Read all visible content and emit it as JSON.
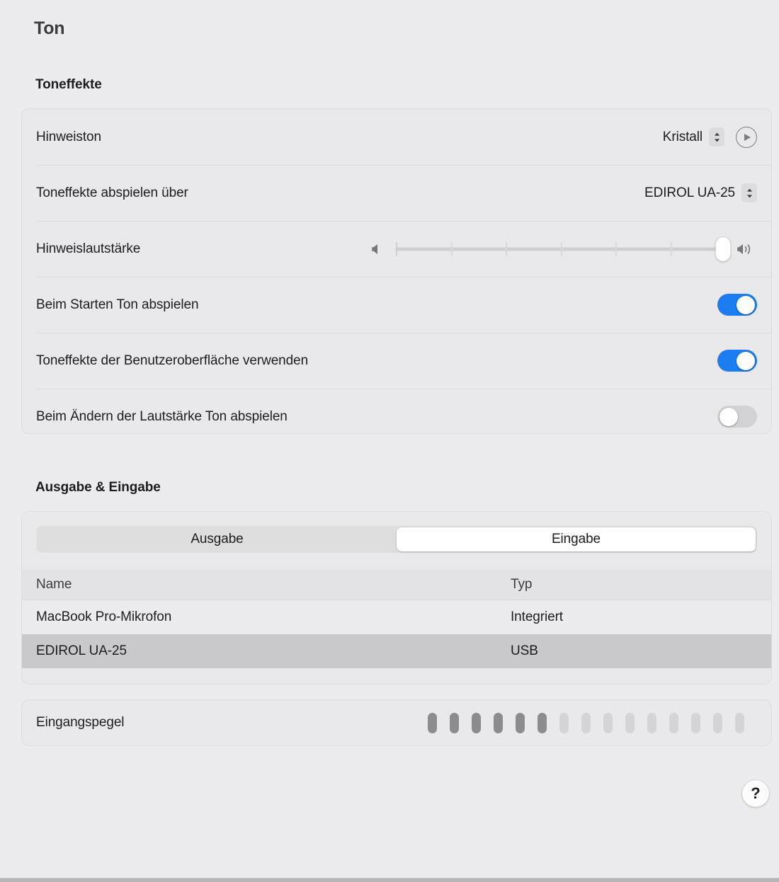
{
  "page": {
    "title": "Ton"
  },
  "sound_effects": {
    "header": "Toneffekte",
    "alert_sound": {
      "label": "Hinweiston",
      "value": "Kristall",
      "play_icon": "play-icon",
      "stepper_icon": "chevron-up-down-icon"
    },
    "play_through": {
      "label": "Toneffekte abspielen über",
      "value": "EDIROL UA-25",
      "stepper_icon": "chevron-up-down-icon"
    },
    "alert_volume": {
      "label": "Hinweislautstärke",
      "value_percent": 100,
      "tick_count": 6,
      "min_icon": "speaker-low-icon",
      "max_icon": "speaker-high-icon"
    },
    "toggles": [
      {
        "label": "Beim Starten Ton abspielen",
        "state": "on"
      },
      {
        "label": "Toneffekte der Benutzeroberfläche verwenden",
        "state": "on"
      },
      {
        "label": "Beim Ändern der Lautstärke Ton abspielen",
        "state": "off"
      }
    ]
  },
  "output_input": {
    "header": "Ausgabe & Eingabe",
    "tabs": [
      {
        "label": "Ausgabe",
        "selected": false
      },
      {
        "label": "Eingabe",
        "selected": true
      }
    ],
    "table": {
      "columns": [
        "Name",
        "Typ"
      ],
      "rows": [
        {
          "name": "MacBook Pro-Mikrofon",
          "type": "Integriert",
          "selected": false
        },
        {
          "name": "EDIROL UA-25",
          "type": "USB",
          "selected": true
        }
      ]
    },
    "input_level": {
      "label": "Eingangspegel",
      "total_segments": 15,
      "filled_segments": 6
    }
  },
  "help": {
    "label": "?",
    "icon": "question-mark-icon"
  },
  "colors": {
    "background": "#ececee",
    "card": "#e9e9eb",
    "accent_blue": "#1c7cf2",
    "selected_row": "#c9c9cc",
    "meter_filled": "#8b8b90",
    "meter_empty": "#d4d4d7"
  }
}
